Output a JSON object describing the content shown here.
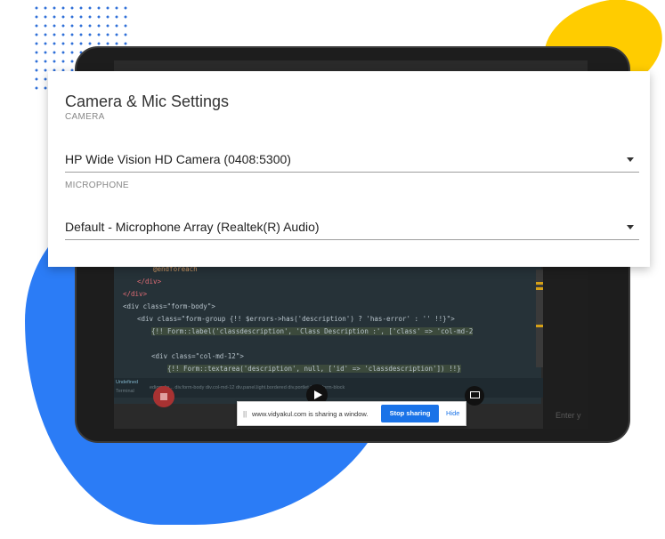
{
  "dialog": {
    "title": "Camera & Mic Settings",
    "camera_label": "CAMERA",
    "camera_value": "HP Wide Vision HD Camera (0408:5300)",
    "microphone_label": "MICROPHONE",
    "microphone_value": "Default - Microphone Array (Realtek(R) Audio)"
  },
  "share_bar": {
    "grip": "||",
    "message": "www.vidyakul.com is sharing a window.",
    "stop_label": "Stop sharing",
    "hide_label": "Hide"
  },
  "code": {
    "line1": "@endforeach",
    "line2": "</div>",
    "line3": "</div>",
    "line4": "<div class=\"form-body\">",
    "line5": "<div class=\"form-group {!! $errors->has('description') ? 'has-error' : '' !!}\">",
    "line6": "{!! Form::label('classdescription', 'Class Description :', ['class' => 'col-md-2",
    "line7": "<div class=\"col-md-12\">",
    "line8": "{!! Form::textarea('description', null, ['id' => 'classdescription']) !!}"
  },
  "status": {
    "left1": "Undefined",
    "left2": "Terminal",
    "items": "ediom-lin...  div.form-body  div.col-md-12  div.panel.light.bordered  div.portlet-body.form-block",
    "right": "Q Send Log  Git master"
  },
  "side_placeholder": "Enter y",
  "colors": {
    "blue_blob": "#2b7cf6",
    "yellow_blob": "#ffcc00",
    "stop_button": "#1a73e8"
  }
}
